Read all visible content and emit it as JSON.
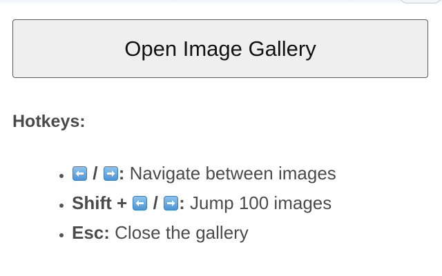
{
  "button": {
    "label": "Open Image Gallery"
  },
  "hotkeys": {
    "heading": "Hotkeys:",
    "items": [
      {
        "keys_separator": "/",
        "colon": ":",
        "description": "Navigate between images",
        "icons": [
          "left-arrow-key-icon",
          "right-arrow-key-icon"
        ]
      },
      {
        "modifier": "Shift +",
        "keys_separator": "/",
        "colon": ":",
        "description": "Jump 100 images",
        "icons": [
          "left-arrow-key-icon",
          "right-arrow-key-icon"
        ]
      },
      {
        "key": "Esc:",
        "description": "Close the gallery"
      }
    ]
  },
  "colors": {
    "key_emoji_blue": "#4b94d6",
    "button_background": "#efefef",
    "text": "#4a4a4a"
  }
}
